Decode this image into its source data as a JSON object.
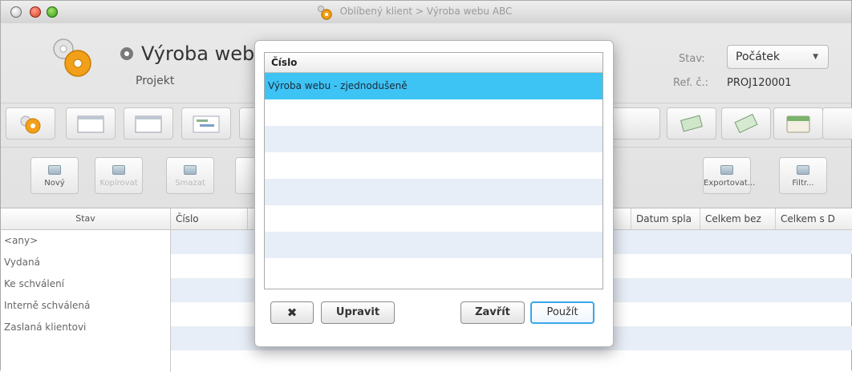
{
  "window": {
    "title": "Oblíbený klient > Výroba webu ABC"
  },
  "header": {
    "title": "Výroba webu ABC",
    "subtitle": "Projekt",
    "stav_label": "Stav:",
    "stav_value": "Počátek",
    "refc_label": "Ref. č.:",
    "refc_value": "PROJ120001"
  },
  "actions": {
    "new": "Nový",
    "copy": "Kopírovat",
    "delete": "Smazat",
    "export": "Exportovat...",
    "filter": "Filtr..."
  },
  "left_panel": {
    "header": "Stav",
    "items": [
      "<any>",
      "Vydaná",
      "Ke schválení",
      "Interně schválená",
      "Zaslaná klientovi"
    ]
  },
  "grid": {
    "columns": [
      "Číslo",
      "",
      "",
      "",
      "",
      "da",
      "Datum spla",
      "Celkem bez",
      "Celkem s D"
    ]
  },
  "dialog": {
    "column_header": "Číslo",
    "rows": [
      "Výroba webu - zjednodušeně",
      "",
      "",
      "",
      "",
      "",
      "",
      ""
    ],
    "delete_icon": "✖",
    "edit_label": "Upravit",
    "close_label": "Zavřít",
    "apply_label": "Použít"
  },
  "colors": {
    "selection": "#3ec3f5",
    "alt_row": "#e8eef7",
    "primary_border": "#3aa6e8"
  },
  "icons": {
    "gear": "gear-icon",
    "bullet": "bullet-icon",
    "close": "close-icon"
  }
}
